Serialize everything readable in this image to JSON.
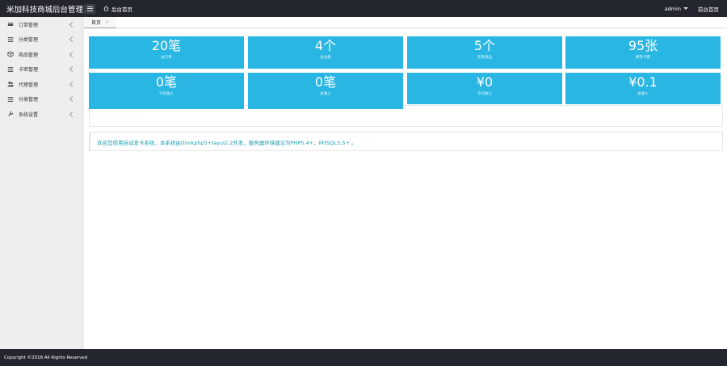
{
  "app": {
    "title": "米加科技商城后台管理"
  },
  "header": {
    "home_link": "后台首页",
    "user": "admin",
    "front_link": "前台首页"
  },
  "sidebar": {
    "items": [
      {
        "label": "订单管理",
        "icon": "credit-card-icon"
      },
      {
        "label": "分类管理",
        "icon": "list-icon"
      },
      {
        "label": "商品管理",
        "icon": "cube-icon"
      },
      {
        "label": "卡密管理",
        "icon": "list-icon"
      },
      {
        "label": "代理管理",
        "icon": "users-icon"
      },
      {
        "label": "分类管理",
        "icon": "list-icon"
      },
      {
        "label": "系统设置",
        "icon": "wrench-icon"
      }
    ]
  },
  "tabs": [
    {
      "label": "首页",
      "close": "×"
    }
  ],
  "stats": [
    {
      "value": "20笔",
      "label": "总订单"
    },
    {
      "value": "4个",
      "label": "总分类"
    },
    {
      "value": "5个",
      "label": "在售商品"
    },
    {
      "value": "95张",
      "label": "库存卡密"
    },
    {
      "value": "0笔",
      "label": "今日收入"
    },
    {
      "value": "0笔",
      "label": "总收入"
    },
    {
      "value": "¥0",
      "label": "今日收入"
    },
    {
      "value": "¥0.1",
      "label": "总收入"
    }
  ],
  "panels": {
    "faint_text": "····································",
    "notice": "欢迎您使用自动发卡系统，本系统由thinkphp5+layui2.2开发，服务器环境建议为PHP5.4+，MYSQL5.5+ 。"
  },
  "footer": {
    "copyright": "Copyright ©2018 All Rights Reserved"
  },
  "colors": {
    "accent": "#29b6e3",
    "header_bg": "#23262e",
    "notice_text": "#1e9fb0"
  }
}
